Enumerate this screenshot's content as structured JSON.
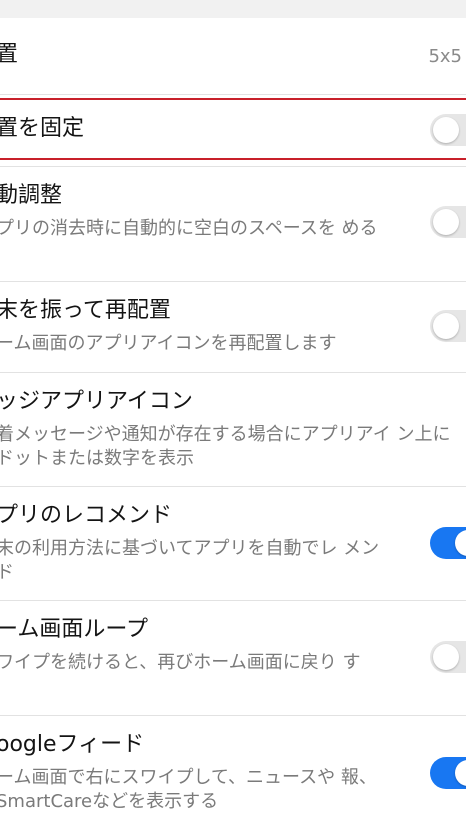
{
  "colors": {
    "accent": "#1877f2",
    "highlight": "#c8202a",
    "toggle_off": "#e6e6e6"
  },
  "settings": {
    "layout": {
      "title": "置",
      "value": "5x5"
    },
    "lock_layout": {
      "title": "置を固定",
      "enabled": false,
      "highlighted": true
    },
    "auto_align": {
      "title": "動調整",
      "subtitle": "プリの消去時に自動的に空白のスペースを める",
      "enabled": false
    },
    "shake_to_rearrange": {
      "title": "末を振って再配置",
      "subtitle": "ーム画面のアプリアイコンを再配置します",
      "enabled": false
    },
    "badge_icons": {
      "title": "ッジアプリアイコン",
      "subtitle": "着メッセージや通知が存在する場合にアプリアイ ン上にドットまたは数字を表示"
    },
    "app_recommend": {
      "title": "プリのレコメンド",
      "subtitle": "末の利用方法に基づいてアプリを自動でレ メンド",
      "enabled": true
    },
    "home_loop": {
      "title": "ーム画面ループ",
      "subtitle": "ワイプを続けると、再びホーム画面に戻り す",
      "enabled": false
    },
    "google_feed": {
      "title": "oogleフィード",
      "subtitle": "ーム画面で右にスワイプして、ニュースや 報、SmartCareなどを表示する",
      "enabled": true
    }
  }
}
